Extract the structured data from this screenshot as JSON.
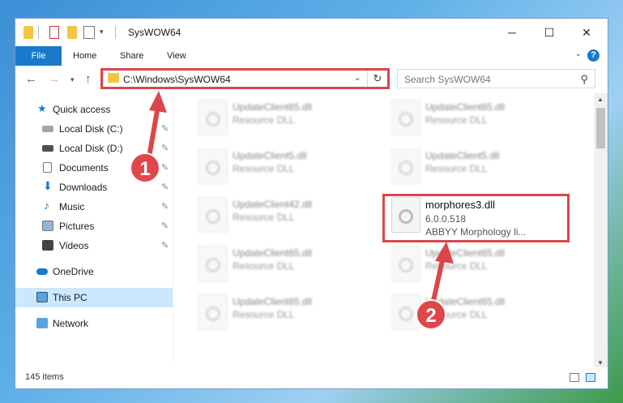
{
  "window": {
    "title": "SysWOW64"
  },
  "ribbon": {
    "file": "File",
    "tabs": [
      "Home",
      "Share",
      "View"
    ],
    "help": "?"
  },
  "address": {
    "path": "C:\\Windows\\SysWOW64"
  },
  "search": {
    "placeholder": "Search SysWOW64"
  },
  "sidebar": {
    "items": [
      {
        "label": "Quick access"
      },
      {
        "label": "Local Disk (C:)"
      },
      {
        "label": "Local Disk (D:)"
      },
      {
        "label": "Documents"
      },
      {
        "label": "Downloads"
      },
      {
        "label": "Music"
      },
      {
        "label": "Pictures"
      },
      {
        "label": "Videos"
      },
      {
        "label": "OneDrive"
      },
      {
        "label": "This PC"
      },
      {
        "label": "Network"
      }
    ]
  },
  "files": [
    {
      "name": "UpdateClient65.dll",
      "desc": "Resource DLL"
    },
    {
      "name": "UpdateClient65.dll",
      "desc": "Resource DLL"
    },
    {
      "name": "UpdateClient5.dll",
      "desc": "Resource DLL"
    },
    {
      "name": "UpdateClient5.dll",
      "desc": "Resource DLL"
    },
    {
      "name": "UpdateClient42.dll",
      "desc": "Resource DLL"
    },
    {
      "name": "morphores3.dll",
      "version": "6.0.0.518",
      "company": "ABBYY Morphology li..."
    },
    {
      "name": "UpdateClient65.dll",
      "desc": "Resource DLL"
    },
    {
      "name": "UpdateClient65.dll",
      "desc": "Resource DLL"
    },
    {
      "name": "UpdateClient65.dll",
      "desc": "Resource DLL"
    },
    {
      "name": "UpdateClient65.dll",
      "desc": "Resource DLL"
    }
  ],
  "status": {
    "items": "145 items"
  },
  "annotations": {
    "step1": "1",
    "step2": "2",
    "color": "#d9474b"
  }
}
